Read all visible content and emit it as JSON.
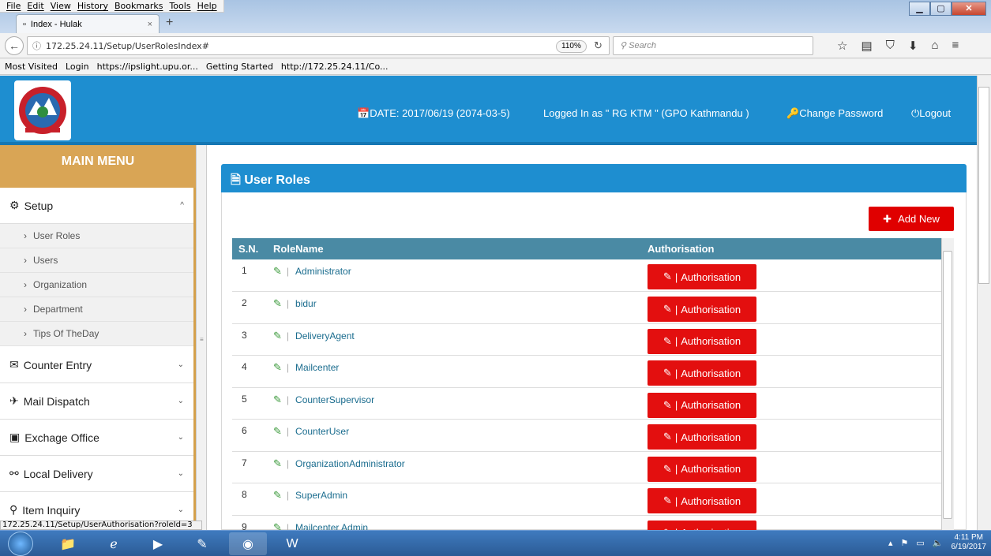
{
  "browser": {
    "menu": [
      "File",
      "Edit",
      "View",
      "History",
      "Bookmarks",
      "Tools",
      "Help"
    ],
    "tab_title": "Index - Hulak",
    "url": "172.25.24.11/Setup/UserRolesIndex#",
    "zoom": "110%",
    "search_placeholder": "Search",
    "bookmarks": [
      "Most Visited",
      "Login",
      "https://ipslight.upu.or...",
      "Getting Started",
      "http://172.25.24.11/Co..."
    ],
    "status_url": "172.25.24.11/Setup/UserAuthorisation?roleId=3"
  },
  "header": {
    "date": "DATE: 2017/06/19 (2074-03-5)",
    "logged_in": "Logged In as \" RG KTM \" (GPO Kathmandu )",
    "change_password": "Change Password",
    "logout": "Logout"
  },
  "sidebar": {
    "title": "MAIN MENU",
    "setup": "Setup",
    "sub_items": [
      "User Roles",
      "Users",
      "Organization",
      "Department",
      "Tips Of TheDay"
    ],
    "items": [
      "Counter Entry",
      "Mail Dispatch",
      "Exchage Office",
      "Local Delivery",
      "Item Inquiry"
    ]
  },
  "panel": {
    "title": "User Roles",
    "add_new": "Add New",
    "columns": [
      "S.N.",
      "RoleName",
      "Authorisation"
    ],
    "auth_label": "Authorisation",
    "rows": [
      {
        "sn": "1",
        "role": "Administrator"
      },
      {
        "sn": "2",
        "role": "bidur"
      },
      {
        "sn": "3",
        "role": "DeliveryAgent"
      },
      {
        "sn": "4",
        "role": "Mailcenter"
      },
      {
        "sn": "5",
        "role": "CounterSupervisor"
      },
      {
        "sn": "6",
        "role": "CounterUser"
      },
      {
        "sn": "7",
        "role": "OrganizationAdministrator"
      },
      {
        "sn": "8",
        "role": "SuperAdmin"
      },
      {
        "sn": "9",
        "role": "Mailcenter Admin"
      }
    ]
  },
  "taskbar": {
    "time": "4:11 PM",
    "date": "6/19/2017"
  }
}
